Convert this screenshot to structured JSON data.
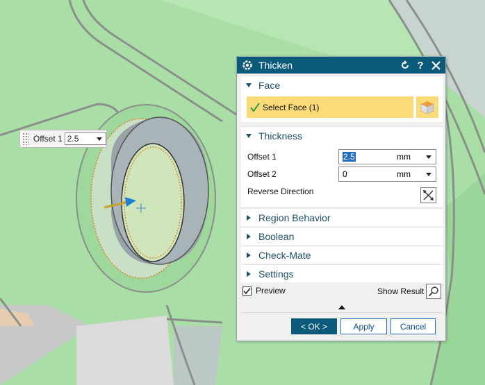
{
  "canvas": {
    "float_widget": {
      "label": "Offset 1",
      "value": "2.5"
    }
  },
  "dialog": {
    "title": "Thicken",
    "title_icons": [
      "reset-icon",
      "help-icon",
      "close-icon"
    ],
    "face_section": {
      "title": "Face",
      "select_label": "Select Face (1)"
    },
    "thickness_section": {
      "title": "Thickness",
      "offset1": {
        "label": "Offset 1",
        "value": "2.5",
        "unit": "mm"
      },
      "offset2": {
        "label": "Offset 2",
        "value": "0",
        "unit": "mm"
      },
      "reverse_label": "Reverse Direction"
    },
    "collapsed_sections": [
      "Region Behavior",
      "Boolean",
      "Check-Mate",
      "Settings"
    ],
    "preview_label": "Preview",
    "preview_checked": true,
    "show_result_label": "Show Result",
    "buttons": {
      "ok": "< OK >",
      "apply": "Apply",
      "cancel": "Cancel"
    }
  },
  "colors": {
    "accent": "#0b5a7a",
    "selection_highlight": "#fbdb78",
    "model_green": "#a9dfa7"
  }
}
